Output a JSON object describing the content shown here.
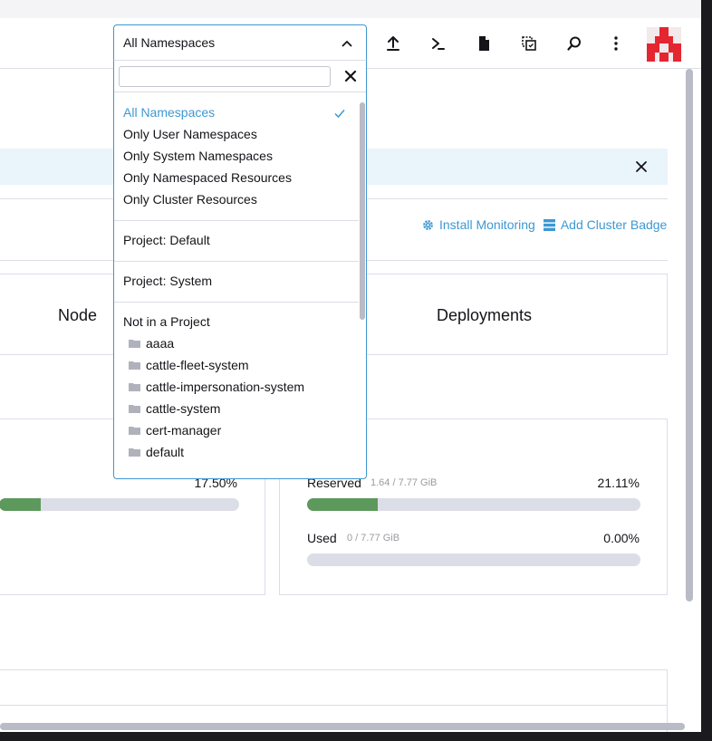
{
  "header": {
    "namespace_filter": {
      "value": "All Namespaces"
    },
    "icons": [
      "upload-icon",
      "terminal-icon",
      "file-icon",
      "copy-kubeconfig-icon",
      "search-icon",
      "more-vertical-icon"
    ]
  },
  "namespace_dropdown": {
    "search": {
      "value": "",
      "placeholder": ""
    },
    "filters": [
      {
        "label": "All Namespaces",
        "selected": true
      },
      {
        "label": "Only User Namespaces"
      },
      {
        "label": "Only System Namespaces"
      },
      {
        "label": "Only Namespaced Resources"
      },
      {
        "label": "Only Cluster Resources"
      }
    ],
    "projects": [
      {
        "label": "Project: Default"
      },
      {
        "label": "Project: System"
      }
    ],
    "not_in_project": {
      "label": "Not in a Project",
      "namespaces": [
        "aaaa",
        "cattle-fleet-system",
        "cattle-impersonation-system",
        "cattle-system",
        "cert-manager",
        "default"
      ]
    }
  },
  "dashboard": {
    "links": {
      "install_monitoring": "Install Monitoring",
      "add_cluster_badge": "Add Cluster Badge"
    },
    "cards": {
      "node": "Node",
      "deployments": "Deployments"
    },
    "left_gauge": {
      "percent": "17.50%",
      "fraction": 0.175
    },
    "memory": {
      "reserved": {
        "label": "Reserved",
        "detail": "1.64 / 7.77 GiB",
        "percent": "21.11%",
        "fraction": 0.2111
      },
      "used": {
        "label": "Used",
        "detail": "0 / 7.77 GiB",
        "percent": "0.00%",
        "fraction": 0
      }
    }
  },
  "colors": {
    "accent": "#3d98d3",
    "progress": "#5d995d",
    "track": "#dcdee7",
    "banner": "#e9f4fb",
    "brand": "#e3262f"
  }
}
